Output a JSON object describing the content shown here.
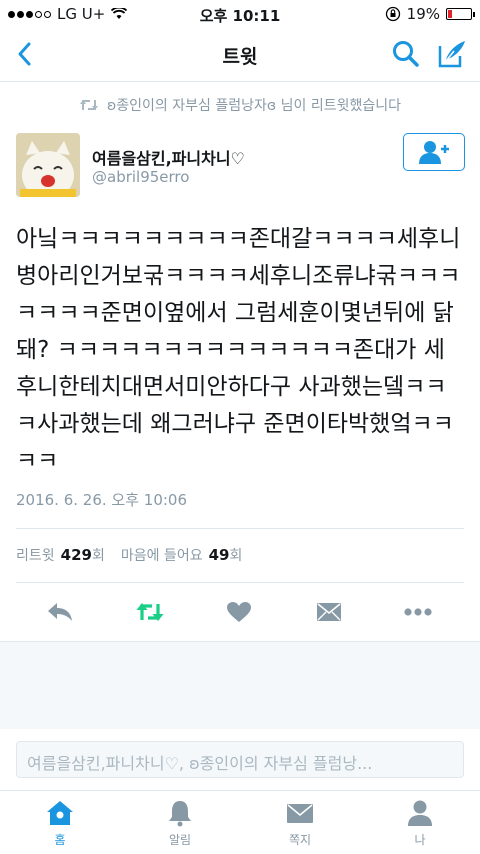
{
  "status_bar": {
    "carrier": "LG U+",
    "time": "오후 10:11",
    "battery_percent": "19%",
    "battery_level": 0.19,
    "signal_bars_filled": 3
  },
  "nav": {
    "title": "트윗",
    "back_icon": "chevron-left-icon",
    "search_icon": "search-icon",
    "compose_icon": "compose-icon"
  },
  "retweet_context": {
    "text": "ʚ종인이의 자부심 플럼낭자ɞ 님이 리트윗했습니다"
  },
  "user": {
    "display_name": "여름을삼킨,파니차니♡",
    "handle": "@abril95erro"
  },
  "tweet": {
    "text": "아닠ㅋㅋㅋㅋㅋㅋㅋㅋㅋ존대갈ㅋㅋㅋㅋ세후니병아리인거보굮ㅋㅋㅋㅋ세후니조류냐굮ㅋㅋㅋㅋㅋㅋㅋ준면이옆에서 그럼세훈이몇년뒤에 닭돼? ㅋㅋㅋㅋㅋㅋㅋㅋㅋㅋㅋㅋㅋㅋ존대가 세후니한테치대면서미안하다구 사과했는뎈ㅋㅋㅋ사과했는데 왜그러냐구 준면이타박했엌ㅋㅋㅋㅋ",
    "timestamp": "2016. 6. 26. 오후 10:06"
  },
  "stats": {
    "retweets_label": "리트윗",
    "retweets_count": "429",
    "retweets_unit": "회",
    "likes_label": "마음에 들어요",
    "likes_count": "49",
    "likes_unit": "회"
  },
  "reply_bar": {
    "placeholder": "여름을삼킨,파니차니♡, ʚ종인이의 자부심 플럼낭..."
  },
  "tabs": [
    {
      "label": "홈",
      "icon": "home-icon",
      "active": true
    },
    {
      "label": "알림",
      "icon": "bell-icon",
      "active": false
    },
    {
      "label": "쪽지",
      "icon": "envelope-icon",
      "active": false
    },
    {
      "label": "나",
      "icon": "person-icon",
      "active": false
    }
  ],
  "colors": {
    "accent": "#1b95e0",
    "retweet_green": "#19cf86",
    "muted": "#8899a6",
    "action_gray": "#aab8c2",
    "battery_red": "#e0242c"
  }
}
